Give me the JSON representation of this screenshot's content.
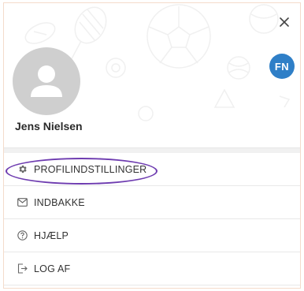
{
  "header": {
    "close_glyph": "×",
    "badge_initials": "FN",
    "user_name": "Jens Nielsen",
    "badge_color": "#2f7fc7"
  },
  "menu": {
    "items": [
      {
        "label": "PROFILINDSTILLINGER",
        "icon": "gear-icon",
        "highlighted": true
      },
      {
        "label": "INDBAKKE",
        "icon": "mail-icon"
      },
      {
        "label": "HJÆLP",
        "icon": "help-circle-icon"
      },
      {
        "label": "LOG AF",
        "icon": "logout-icon"
      }
    ]
  },
  "colors": {
    "highlight_ring": "#6e3cb0",
    "avatar_bg": "#cfcfcf",
    "text": "#333333"
  }
}
